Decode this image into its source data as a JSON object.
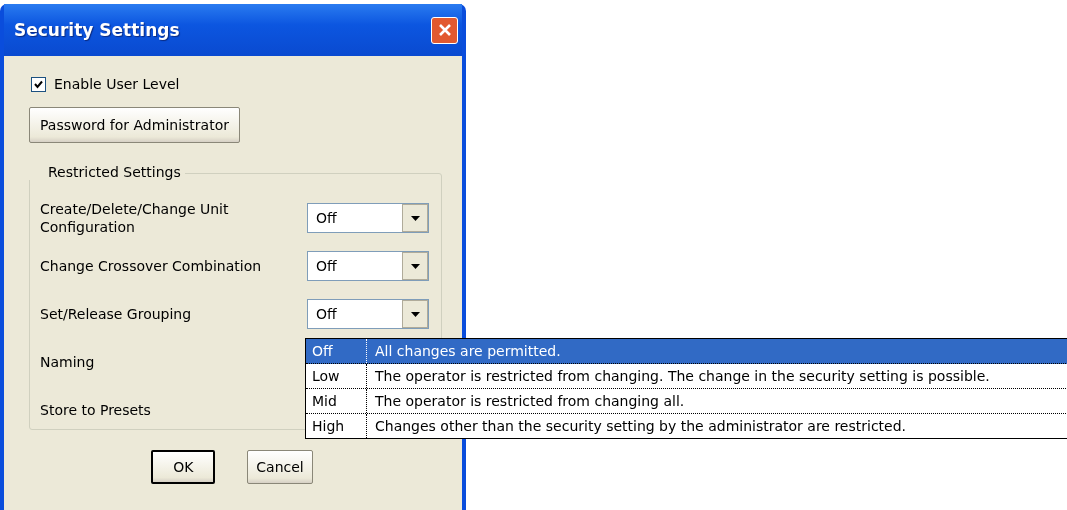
{
  "window": {
    "title": "Security Settings"
  },
  "enable_user_level": {
    "label": "Enable User Level",
    "checked": true
  },
  "password_button": {
    "label": "Password for Administrator"
  },
  "restricted_settings": {
    "title": "Restricted Settings",
    "rows": [
      {
        "label": "Create/Delete/Change Unit Configuration",
        "value": "Off"
      },
      {
        "label": "Change Crossover Combination",
        "value": "Off"
      },
      {
        "label": "Set/Release Grouping",
        "value": "Off"
      },
      {
        "label": "Naming"
      },
      {
        "label": "Store to Presets"
      }
    ]
  },
  "dropdown_list": {
    "options": [
      {
        "level": "Off",
        "description": "All changes are permitted.",
        "selected": true
      },
      {
        "level": "Low",
        "description": "The operator is restricted from changing. The change in the security setting is possible.",
        "selected": false
      },
      {
        "level": "Mid",
        "description": "The operator is restricted from changing all.",
        "selected": false
      },
      {
        "level": "High",
        "description": "Changes other than the security setting by the administrator are restricted.",
        "selected": false
      }
    ]
  },
  "buttons": [
    {
      "label": "OK",
      "default": true
    },
    {
      "label": "Cancel",
      "default": false
    }
  ]
}
